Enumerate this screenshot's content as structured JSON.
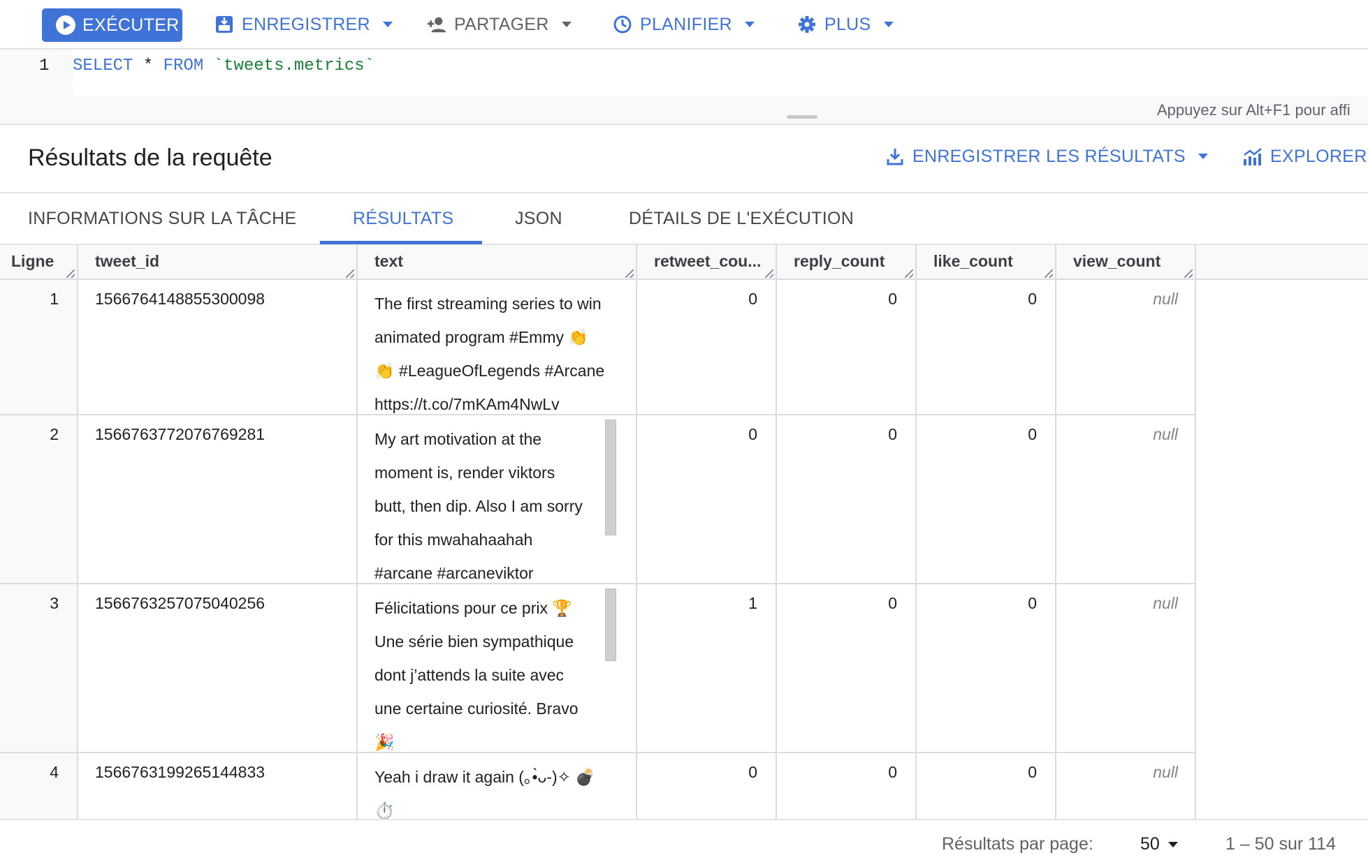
{
  "toolbar": {
    "run_label": "EXÉCUTER",
    "save_label": "ENREGISTRER",
    "share_label": "PARTAGER",
    "schedule_label": "PLANIFIER",
    "more_label": "PLUS"
  },
  "editor": {
    "line_number": "1",
    "code_keyword_select": "SELECT",
    "code_star": "*",
    "code_keyword_from": "FROM",
    "code_table": "`tweets.metrics`",
    "hint": "Appuyez sur Alt+F1 pour affi"
  },
  "results": {
    "title": "Résultats de la requête",
    "save_results_label": "ENREGISTRER LES RÉSULTATS",
    "explore_label": "EXPLORER L"
  },
  "tabs": [
    "INFORMATIONS SUR LA TÂCHE",
    "RÉSULTATS",
    "JSON",
    "DÉTAILS DE L'EXÉCUTION"
  ],
  "table": {
    "columns": [
      "Ligne",
      "tweet_id",
      "text",
      "retweet_cou...",
      "reply_count",
      "like_count",
      "view_count"
    ],
    "rows": [
      {
        "line": "1",
        "tweet_id": "1566764148855300098",
        "text": [
          "The first streaming series to win",
          "animated program #Emmy 👏",
          "👏 #LeagueOfLegends #Arcane",
          "https://t.co/7mKAm4NwLv"
        ],
        "retweet_count": "0",
        "reply_count": "0",
        "like_count": "0",
        "view_count": "null"
      },
      {
        "line": "2",
        "tweet_id": "1566763772076769281",
        "text": [
          "My art motivation at the",
          "moment is, render viktors",
          "butt, then dip. Also I am sorry",
          "for this mwahahaahah",
          "#arcane #arcaneviktor"
        ],
        "retweet_count": "0",
        "reply_count": "0",
        "like_count": "0",
        "view_count": "null"
      },
      {
        "line": "3",
        "tweet_id": "1566763257075040256",
        "text": [
          "Félicitations pour ce prix 🏆",
          "Une série bien sympathique",
          "dont j’attends la suite avec",
          "une certaine curiosité. Bravo",
          "🎉"
        ],
        "retweet_count": "1",
        "reply_count": "0",
        "like_count": "0",
        "view_count": "null"
      },
      {
        "line": "4",
        "tweet_id": "1566763199265144833",
        "text": [
          "Yeah i draw it again (｡•̀ᴗ-)✧ 💣",
          "⏱️"
        ],
        "retweet_count": "0",
        "reply_count": "0",
        "like_count": "0",
        "view_count": "null"
      }
    ]
  },
  "pagination": {
    "per_page_label": "Résultats par page:",
    "per_page_value": "50",
    "range": "1 – 50 sur 114"
  }
}
